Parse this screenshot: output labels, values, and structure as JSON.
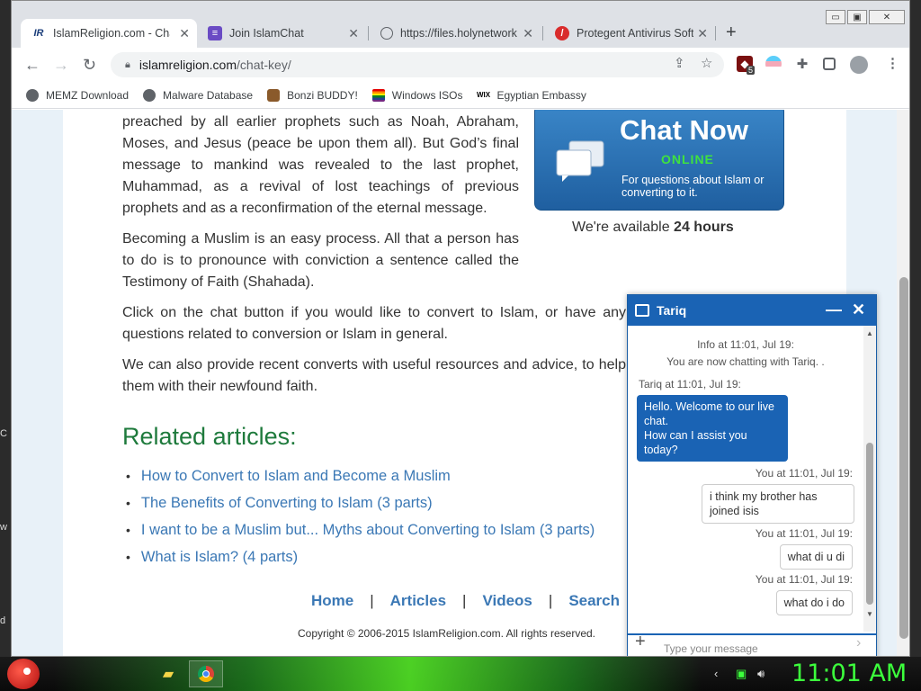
{
  "browser": {
    "tabs": [
      {
        "title": "IslamReligion.com - Cha",
        "favicon": "IR",
        "active": true
      },
      {
        "title": "Join IslamChat",
        "favicon": "form-icon",
        "active": false
      },
      {
        "title": "https://files.holynetwork",
        "favicon": "globe-icon",
        "active": false
      },
      {
        "title": "Protegent Antivirus Soft",
        "favicon": "shield-icon",
        "active": false
      }
    ],
    "close_glyph": "✕",
    "new_tab_glyph": "+",
    "window_controls": {
      "minimize": "▭",
      "restore": "▣",
      "close": "✕"
    },
    "url_host": "islamreligion.com",
    "url_path": "/chat-key/",
    "extension_badge": "5",
    "bookmarks": [
      {
        "label": "MEMZ Download",
        "icon": "globe-icon"
      },
      {
        "label": "Malware Database",
        "icon": "globe-icon"
      },
      {
        "label": "Bonzi BUDDY!",
        "icon": "bonzi-icon"
      },
      {
        "label": "Windows ISOs",
        "icon": "rainbow-icon"
      },
      {
        "label": "Egyptian Embassy",
        "icon": "wix-icon"
      }
    ]
  },
  "page": {
    "para1": "preached by all earlier prophets such as Noah, Abraham, Moses, and Jesus (peace be upon them all). But God’s final message to mankind was revealed to the last prophet, Muhammad, as a revival of lost teachings of previous prophets and as a reconfirmation of the eternal message.",
    "para2": "Becoming a Muslim is an easy process. All that a person has to do is to pronounce with conviction a sentence called the Testimony of Faith (Shahada).",
    "para3": "Click on the chat button if you would like to convert to Islam, or have any questions related to conversion or Islam in general.",
    "para4": "We can also provide recent converts with useful resources and advice, to help them with their newfound faith.",
    "chat_now": {
      "title": "Chat Now",
      "status": "ONLINE",
      "subtitle": "For questions about Islam or converting to it."
    },
    "avail_prefix": "We're available ",
    "avail_hours": "24 hours",
    "related_heading": "Related articles:",
    "related": [
      "How to Convert to Islam and Become a Muslim",
      "The Benefits of Converting to Islam (3 parts)",
      "I want to be a Muslim but... Myths about Converting to Islam (3 parts)",
      "What is Islam? (4 parts)"
    ],
    "footer_nav": [
      "Home",
      "Articles",
      "Videos",
      "Search"
    ],
    "footer_sep": "|",
    "copyright": "Copyright © 2006-2015 IslamReligion.com. All rights reserved."
  },
  "chat": {
    "agent_name": "Tariq",
    "info_time": "Info at 11:01, Jul 19:",
    "info_text": "You are now chatting with Tariq. .",
    "agent_time": "Tariq at 11:01, Jul 19:",
    "agent_msg": "Hello. Welcome to our live chat.\nHow can I assist you today?",
    "me_time_1": "You at 11:01, Jul 19:",
    "me_msg_1": "i think my brother has joined isis",
    "me_time_2": "You at 11:01, Jul 19:",
    "me_msg_2": "what di u di",
    "me_time_3": "You at 11:01, Jul 19:",
    "me_msg_3": "what do i do",
    "input_placeholder": "Type your message"
  },
  "taskbar": {
    "clock": "11:01 AM"
  },
  "colors": {
    "chat_blue": "#1a63b4",
    "link_blue": "#3b78b5",
    "heading_green": "#1e7a3c",
    "online_green": "#3fe23f",
    "clock_green": "#3cff3c"
  }
}
